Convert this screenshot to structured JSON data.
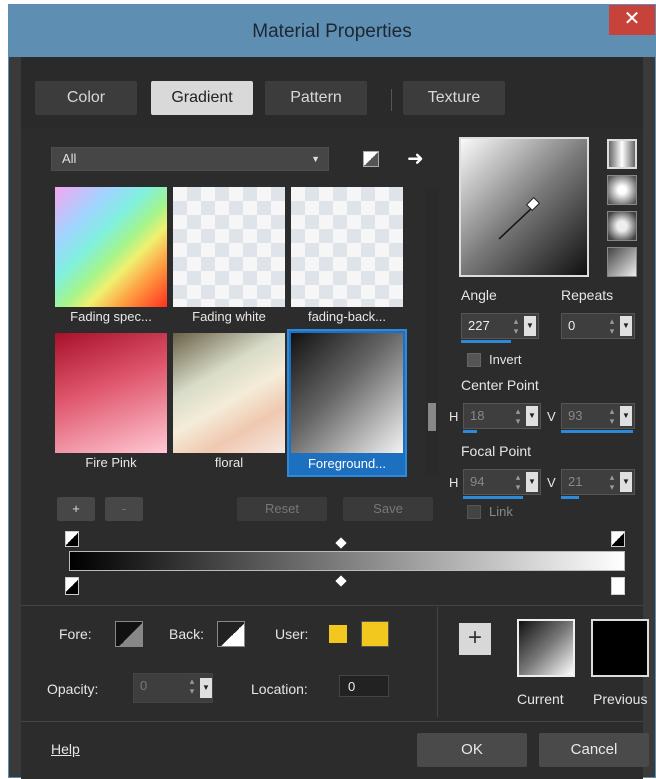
{
  "window": {
    "title": "Material Properties",
    "close_glyph": "✕"
  },
  "tabs": [
    {
      "label": "Color",
      "active": false
    },
    {
      "label": "Gradient",
      "active": true
    },
    {
      "label": "Pattern",
      "active": false
    },
    {
      "label": "Texture",
      "active": false
    }
  ],
  "filter": {
    "selected": "All"
  },
  "gradients": [
    {
      "label": "Fading spec..."
    },
    {
      "label": "Fading white"
    },
    {
      "label": "fading-back..."
    },
    {
      "label": "Fire Pink"
    },
    {
      "label": "floral"
    },
    {
      "label": "Foreground...",
      "selected": true
    }
  ],
  "list_buttons": {
    "add": "+",
    "remove": "-",
    "reset": "Reset",
    "save": "Save"
  },
  "angle": {
    "label": "Angle",
    "value": "227"
  },
  "repeats": {
    "label": "Repeats",
    "value": "0"
  },
  "invert": {
    "label": "Invert",
    "checked": false
  },
  "center_point": {
    "label": "Center Point",
    "h_label": "H",
    "h_value": "18",
    "v_label": "V",
    "v_value": "93"
  },
  "focal_point": {
    "label": "Focal Point",
    "h_label": "H",
    "h_value": "94",
    "v_label": "V",
    "v_value": "21"
  },
  "link": {
    "label": "Link",
    "checked": false
  },
  "bottom": {
    "fore_label": "Fore:",
    "back_label": "Back:",
    "user_label": "User:",
    "user_color": "#f2c81e",
    "opacity_label": "Opacity:",
    "opacity_value": "0",
    "location_label": "Location:",
    "location_value": "0",
    "add_glyph": "+",
    "current_label": "Current",
    "previous_label": "Previous"
  },
  "footer": {
    "help": "Help",
    "ok": "OK",
    "cancel": "Cancel"
  },
  "colors": {
    "accent": "#2e8ad8",
    "titlebar": "#5e8fb3",
    "close": "#c7423a"
  }
}
